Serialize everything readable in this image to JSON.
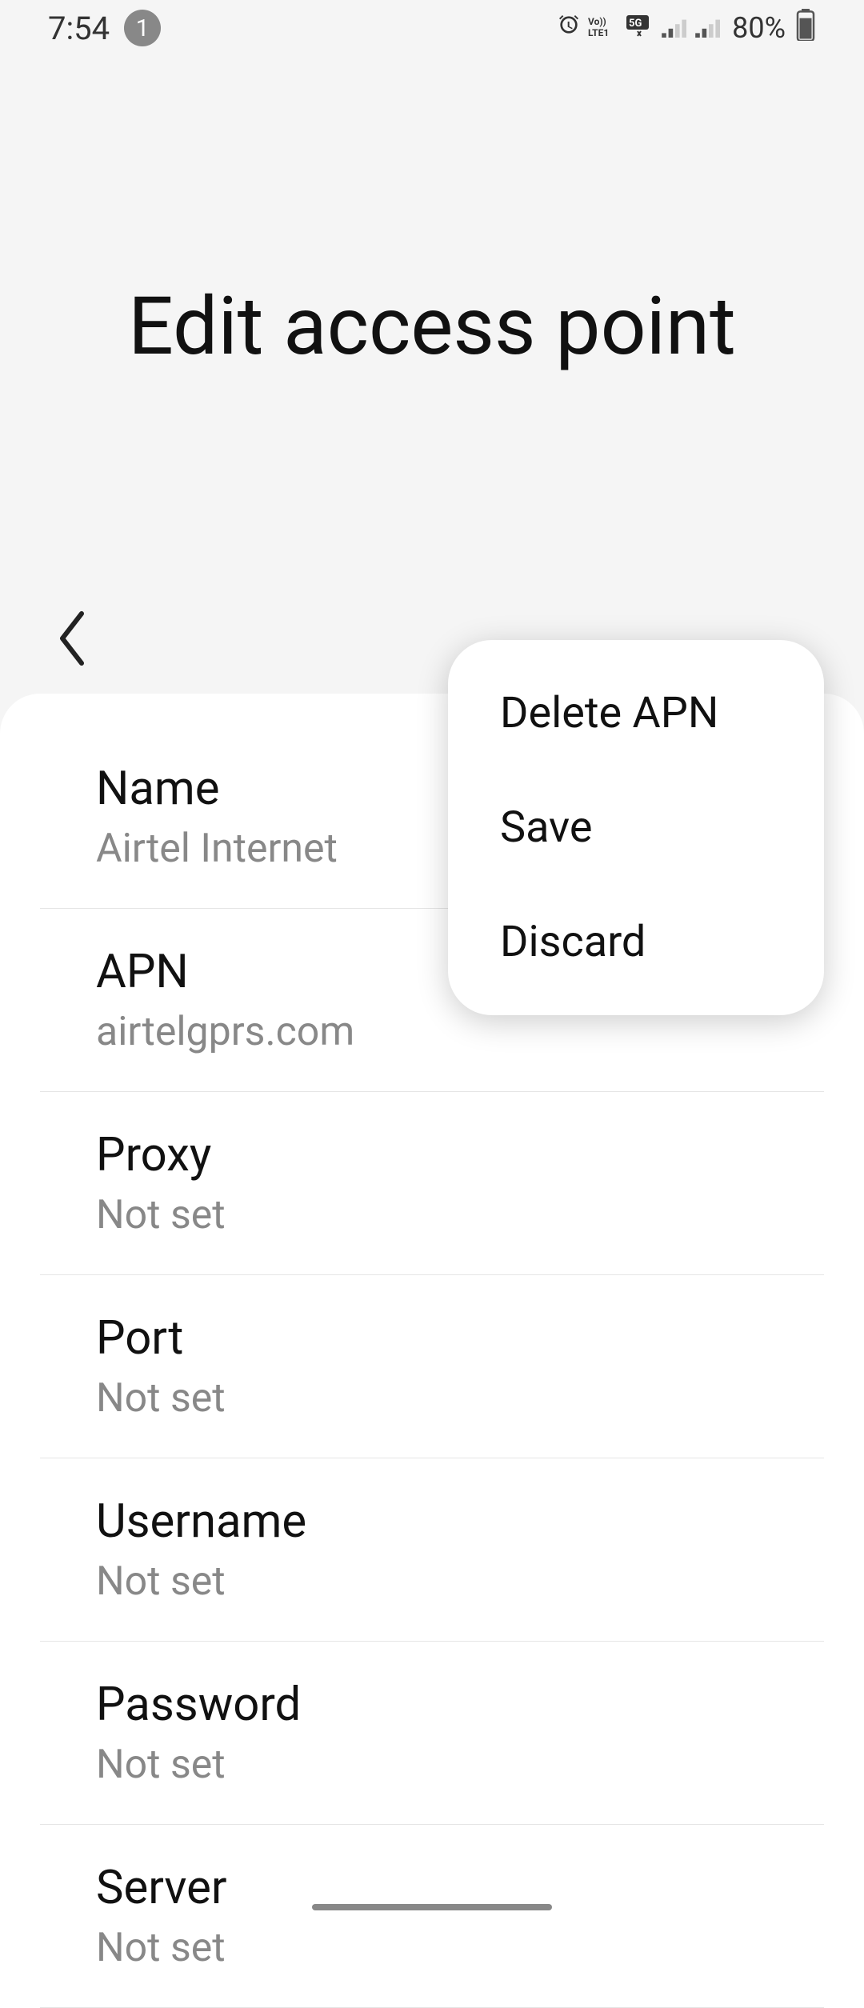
{
  "status_bar": {
    "time": "7:54",
    "notification_count": "1",
    "battery_percent": "80%",
    "indicators": {
      "volte": "VoLTE1",
      "network": "5G"
    }
  },
  "header": {
    "title": "Edit access point"
  },
  "menu": {
    "items": [
      {
        "label": "Delete APN"
      },
      {
        "label": "Save"
      },
      {
        "label": "Discard"
      }
    ]
  },
  "fields": [
    {
      "label": "Name",
      "value": "Airtel Internet"
    },
    {
      "label": "APN",
      "value": "airtelgprs.com"
    },
    {
      "label": "Proxy",
      "value": "Not set"
    },
    {
      "label": "Port",
      "value": "Not set"
    },
    {
      "label": "Username",
      "value": "Not set"
    },
    {
      "label": "Password",
      "value": "Not set"
    },
    {
      "label": "Server",
      "value": "Not set"
    }
  ]
}
